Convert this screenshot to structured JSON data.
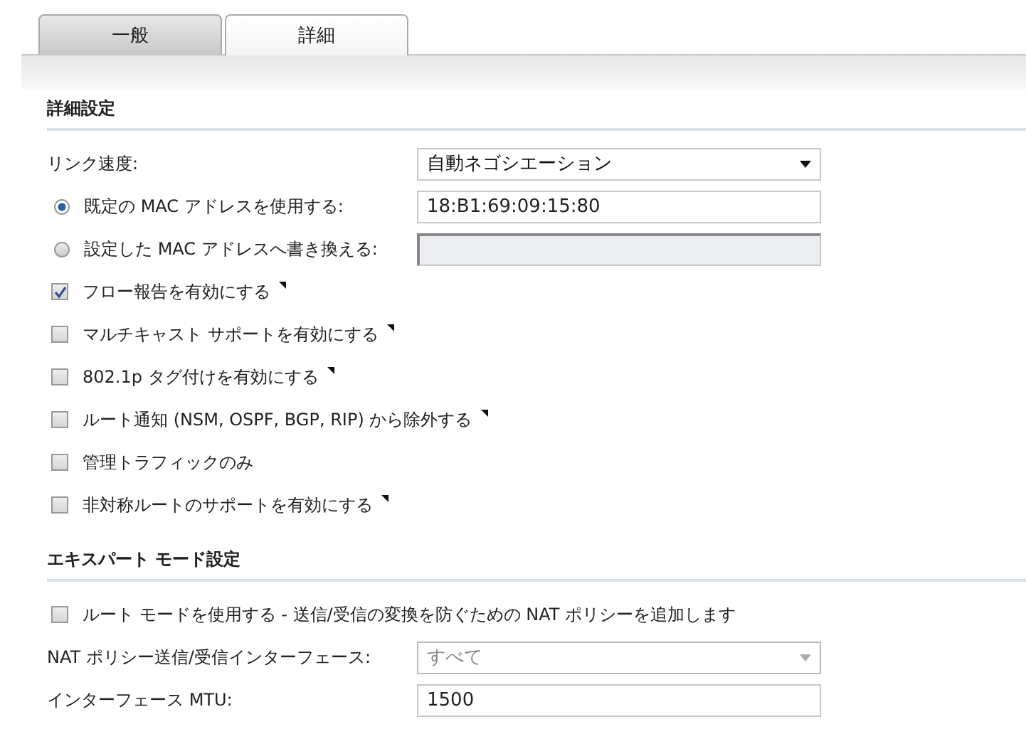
{
  "tabs": [
    {
      "label": "一般",
      "selected": false
    },
    {
      "label": "詳細",
      "selected": true
    }
  ],
  "sections": [
    {
      "title": "詳細設定",
      "rows": [
        {
          "kind": "select",
          "label": "リンク速度:",
          "value": "自動ネゴシエーション",
          "disabled": false
        },
        {
          "kind": "radio",
          "label": "既定の MAC アドレスを使用する:",
          "selected": true,
          "field": {
            "value": "18:B1:69:09:15:80",
            "disabled": false
          }
        },
        {
          "kind": "radio",
          "label": "設定した MAC アドレスへ書き換える:",
          "selected": false,
          "field": {
            "disabled": true
          }
        },
        {
          "kind": "check",
          "label": "フロー報告を有効にする",
          "checked": true,
          "tip": true
        },
        {
          "kind": "check",
          "label": "マルチキャスト サポートを有効にする",
          "checked": false,
          "tip": true
        },
        {
          "kind": "check",
          "label": "802.1p タグ付けを有効にする",
          "checked": false,
          "tip": true
        },
        {
          "kind": "check",
          "label": "ルート通知 (NSM, OSPF, BGP, RIP) から除外する",
          "checked": false,
          "tip": true
        },
        {
          "kind": "check",
          "label": "管理トラフィックのみ",
          "checked": false,
          "tip": false
        },
        {
          "kind": "check",
          "label": "非対称ルートのサポートを有効にする",
          "checked": false,
          "tip": true
        }
      ]
    },
    {
      "title": "エキスパート モード設定",
      "rows": [
        {
          "kind": "check",
          "label": "ルート モードを使用する - 送信/受信の変換を防ぐための NAT ポリシーを追加します",
          "checked": false,
          "tip": false
        },
        {
          "kind": "select",
          "label": "NAT ポリシー送信/受信インターフェース:",
          "value": "すべて",
          "disabled": true
        },
        {
          "kind": "text",
          "label": "インターフェース MTU:",
          "value": "1500",
          "disabled": false
        }
      ]
    }
  ]
}
